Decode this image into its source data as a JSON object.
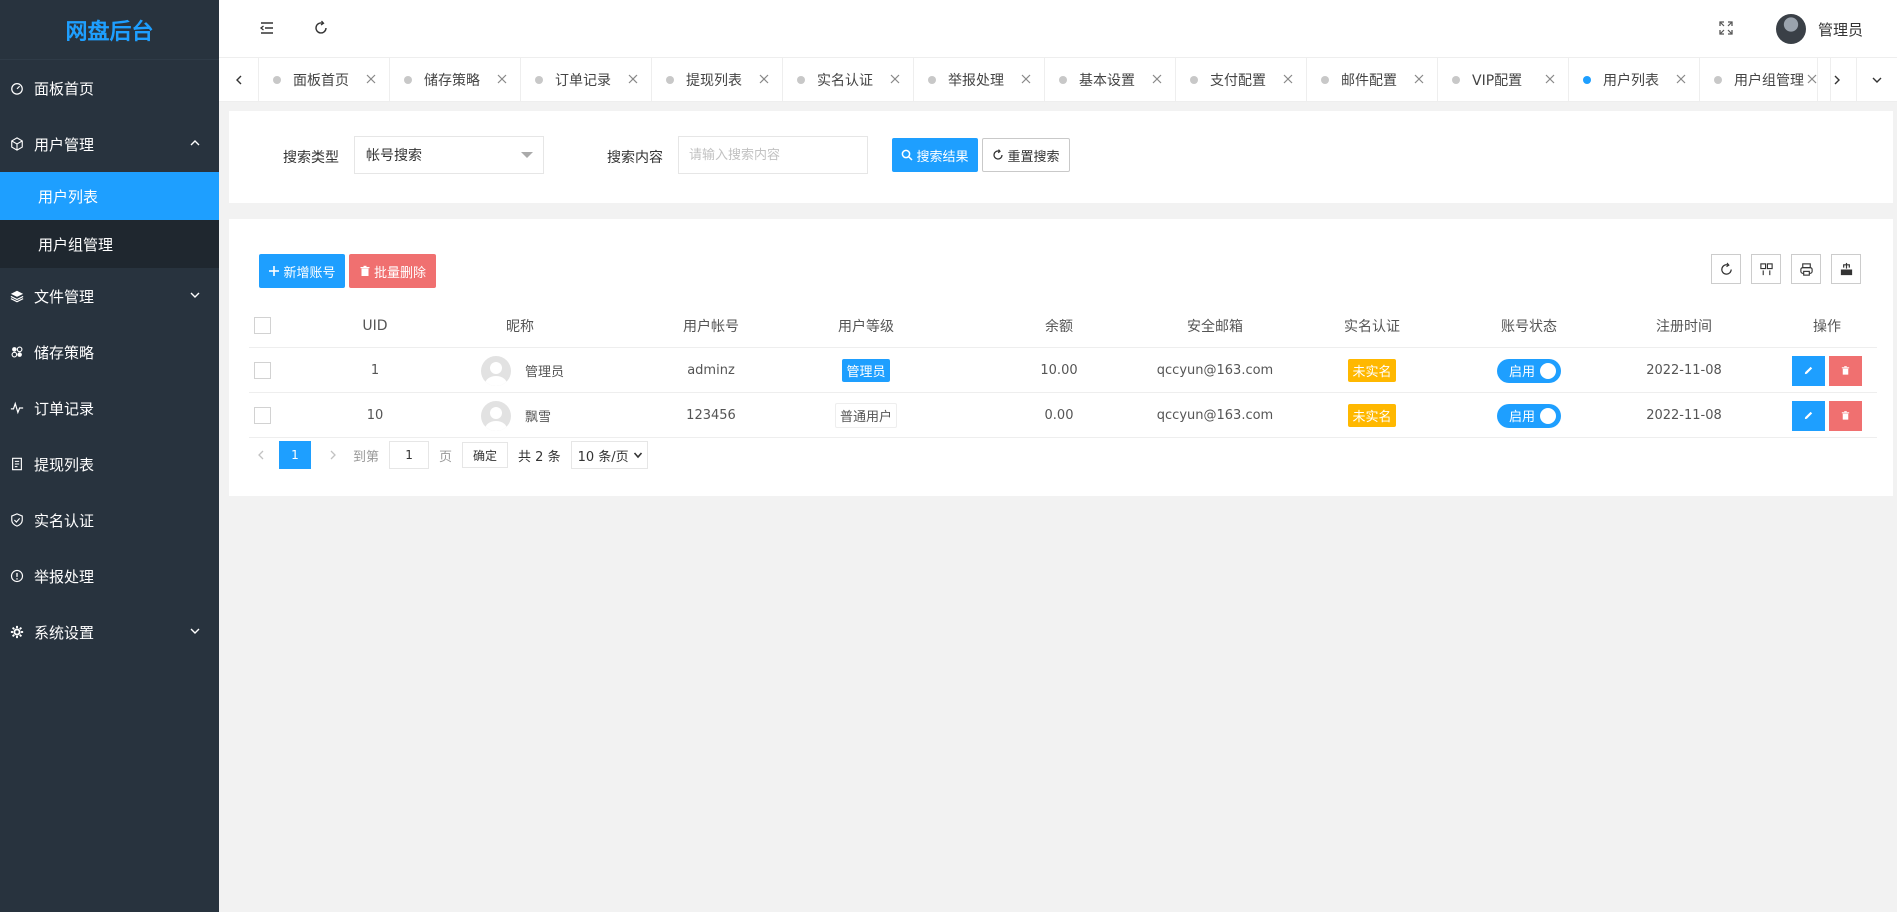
{
  "sidebar": {
    "logo": "网盘后台",
    "items": [
      {
        "label": "面板首页",
        "icon": "dashboard-icon"
      },
      {
        "label": "用户管理",
        "icon": "cube-icon",
        "expanded": true,
        "children": [
          {
            "label": "用户列表",
            "active": true
          },
          {
            "label": "用户组管理"
          }
        ]
      },
      {
        "label": "文件管理",
        "icon": "layers-icon",
        "expandable": true
      },
      {
        "label": "储存策略",
        "icon": "flower-icon"
      },
      {
        "label": "订单记录",
        "icon": "pulse-icon"
      },
      {
        "label": "提现列表",
        "icon": "doc-icon"
      },
      {
        "label": "实名认证",
        "icon": "shield-icon"
      },
      {
        "label": "举报处理",
        "icon": "info-icon"
      },
      {
        "label": "系统设置",
        "icon": "gear-icon",
        "expandable": true
      }
    ]
  },
  "header": {
    "user_name": "管理员"
  },
  "tabs": [
    {
      "label": "面板首页"
    },
    {
      "label": "储存策略"
    },
    {
      "label": "订单记录"
    },
    {
      "label": "提现列表"
    },
    {
      "label": "实名认证"
    },
    {
      "label": "举报处理"
    },
    {
      "label": "基本设置"
    },
    {
      "label": "支付配置"
    },
    {
      "label": "邮件配置"
    },
    {
      "label": "VIP配置"
    },
    {
      "label": "用户列表",
      "active": true
    },
    {
      "label": "用户组管理"
    }
  ],
  "search": {
    "type_label": "搜索类型",
    "type_value": "帐号搜索",
    "content_label": "搜索内容",
    "content_placeholder": "请输入搜索内容",
    "search_button": "搜索结果",
    "reset_button": "重置搜索"
  },
  "toolbar": {
    "add_button": "新增账号",
    "batch_delete_button": "批量删除"
  },
  "table": {
    "columns": [
      "UID",
      "昵称",
      "用户帐号",
      "用户等级",
      "余额",
      "安全邮箱",
      "实名认证",
      "账号状态",
      "注册时间",
      "操作"
    ],
    "rows": [
      {
        "uid": "1",
        "nickname": "管理员",
        "account": "adminz",
        "level": "管理员",
        "level_style": "blue",
        "balance": "10.00",
        "email": "qccyun@163.com",
        "verify": "未实名",
        "status": "启用",
        "reg_time": "2022-11-08"
      },
      {
        "uid": "10",
        "nickname": "飘雪",
        "account": "123456",
        "level": "普通用户",
        "level_style": "plain",
        "balance": "0.00",
        "email": "qccyun@163.com",
        "verify": "未实名",
        "status": "启用",
        "reg_time": "2022-11-08"
      }
    ]
  },
  "pager": {
    "current_page": "1",
    "goto_label": "到第",
    "goto_value": "1",
    "page_unit": "页",
    "confirm": "确定",
    "total": "共 2 条",
    "page_size": "10 条/页"
  },
  "colors": {
    "primary": "#1e9fff",
    "danger": "#f07070",
    "warning": "#ffb800",
    "sidebar": "#28333e"
  }
}
